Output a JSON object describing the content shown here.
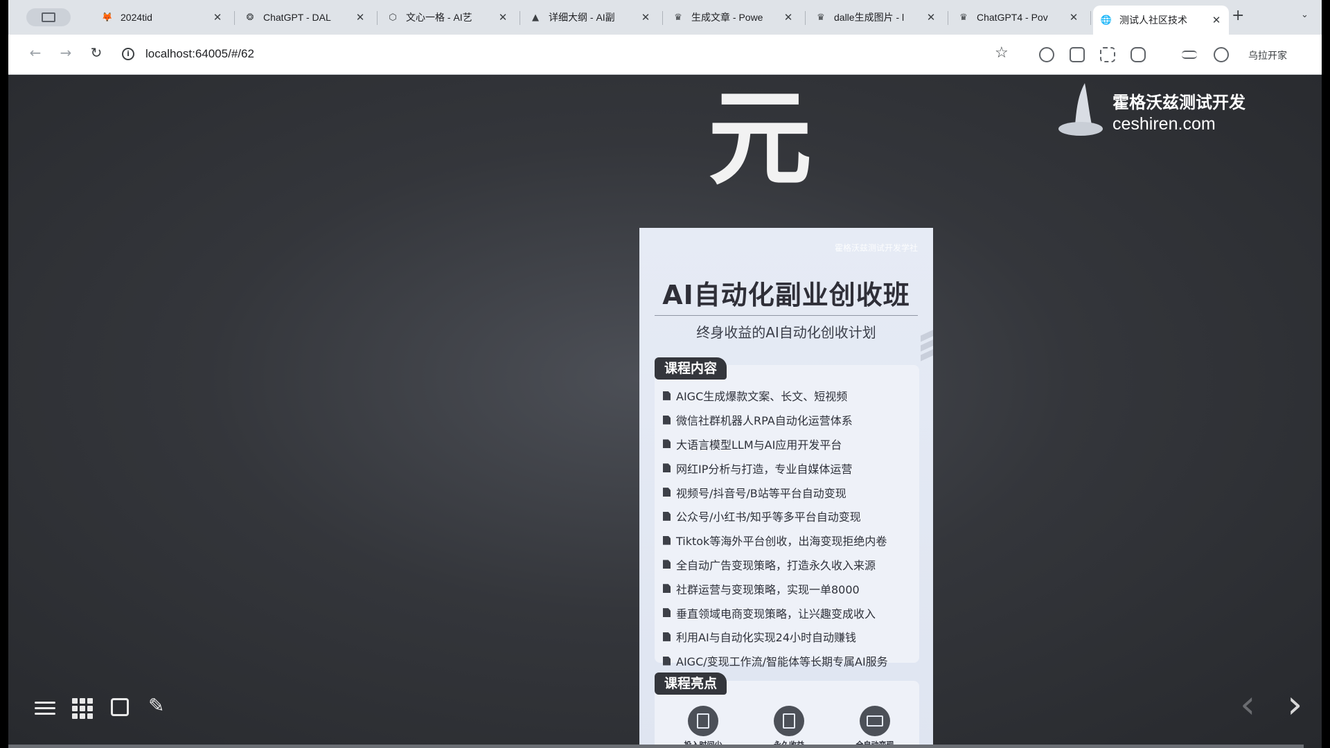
{
  "browser": {
    "tabs": [
      {
        "title": "2024tid",
        "icon": "gitlab-icon"
      },
      {
        "title": "ChatGPT - DAL",
        "icon": "openai-icon"
      },
      {
        "title": "文心一格 - AI艺",
        "icon": "cube-icon"
      },
      {
        "title": "详细大纲 - AI副",
        "icon": "hat-icon"
      },
      {
        "title": "生成文章 - Powe",
        "icon": "crown-icon"
      },
      {
        "title": "dalle生成图片 - l",
        "icon": "crown-icon"
      },
      {
        "title": "ChatGPT4 - Pov",
        "icon": "crown-icon"
      },
      {
        "title": "测试人社区技术",
        "icon": "globe-icon"
      }
    ],
    "close_glyph": "✕",
    "new_tab": "+",
    "url": "localhost:64005/#/62",
    "profile_label": "乌拉开家"
  },
  "slide": {
    "big_char": "元",
    "logo_cn": "霍格沃兹测试开发",
    "logo_en": "ceshiren.com",
    "poster": {
      "brand": "霍格沃兹测试开发学社",
      "title": "AI自动化副业创收班",
      "subtitle": "终身收益的AI自动化创收计划",
      "content_header": "课程内容",
      "items": [
        "AIGC生成爆款文案、长文、短视频",
        "微信社群机器人RPA自动化运营体系",
        "大语言模型LLM与AI应用开发平台",
        "网红IP分析与打造，专业自媒体运营",
        "视频号/抖音号/B站等平台自动变现",
        "公众号/小红书/知乎等多平台自动变现",
        "Tiktok等海外平台创收，出海变现拒绝内卷",
        "全自动广告变现策略，打造永久收入来源",
        "社群运营与变现策略，实现一单8000",
        "垂直领域电商变现策略，让兴趣变成收入",
        "利用AI与自动化实现24小时自动赚钱",
        "AIGC/变现工作流/智能体等长期专属AI服务"
      ],
      "highlights_header": "课程亮点",
      "highlights": [
        "投入时间少",
        "永久收益",
        "全自动变现"
      ]
    }
  },
  "controls": {
    "prev_glyph": "‹",
    "next_glyph": "›"
  }
}
